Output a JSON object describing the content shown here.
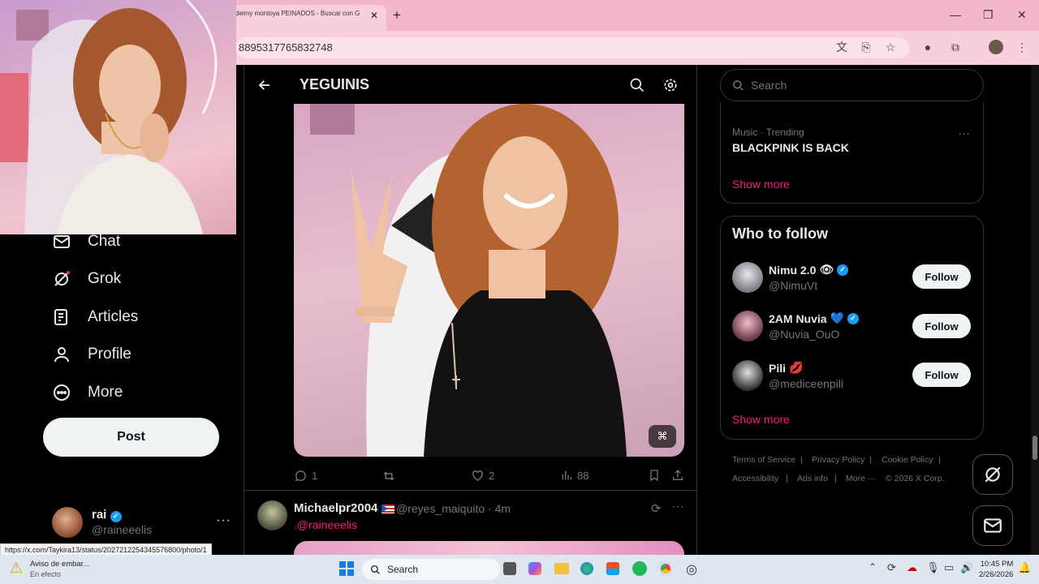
{
  "browser": {
    "tab_title": "deimy montoya PEINADOS - Buscar con G",
    "url_fragment": "8895317765832748",
    "status_url": "https://x.com/Taykira13/status/2027212254345576800/photo/1"
  },
  "nav": {
    "items": [
      {
        "label": "Chat",
        "icon": "envelope-icon"
      },
      {
        "label": "Grok",
        "icon": "grok-icon"
      },
      {
        "label": "Articles",
        "icon": "article-icon"
      },
      {
        "label": "Profile",
        "icon": "person-icon"
      },
      {
        "label": "More",
        "icon": "more-circle-icon"
      }
    ],
    "post_label": "Post",
    "account": {
      "name": "rai",
      "handle": "@raineeelis"
    }
  },
  "header": {
    "title": "YEGUINIS"
  },
  "tweet": {
    "replies": "1",
    "reposts": "",
    "likes": "2",
    "views": "88"
  },
  "reply": {
    "name": "Michaelpr2004",
    "handle": "@reyes_maiquito · 4m",
    "text": ".@raineeelis"
  },
  "right": {
    "search_placeholder": "Search",
    "trend": {
      "category": "Music · Trending",
      "title": "BLACKPINK IS BACK"
    },
    "show_more": "Show more",
    "who_to_follow": "Who to follow",
    "follow_label": "Follow",
    "suggestions": [
      {
        "name": "Nimu 2.0",
        "emoji": "👁",
        "verified": true,
        "handle": "@NimuVt"
      },
      {
        "name": "2AM Nuvia",
        "emoji": "💙",
        "verified": true,
        "handle": "@Nuvia_OuO"
      },
      {
        "name": "Pili",
        "emoji": "💋",
        "verified": false,
        "handle": "@mediceenpili"
      }
    ],
    "footer": [
      "Terms of Service",
      "Privacy Policy",
      "Cookie Policy",
      "Accessibility",
      "Ads info",
      "More ···",
      "© 2026 X Corp."
    ]
  },
  "taskbar": {
    "notice_title": "Aviso de embar...",
    "notice_sub": "En efecto",
    "search_label": "Search",
    "time": "10:45 PM",
    "date": "2/26/2026"
  }
}
